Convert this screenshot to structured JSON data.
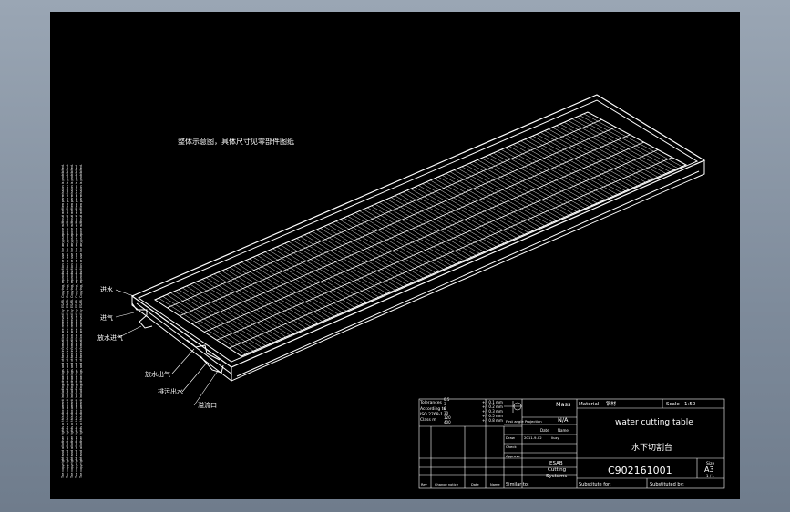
{
  "drawing": {
    "note": "整体示意图，具体尺寸见零部件图纸",
    "labels": {
      "inlet_water": "进水",
      "inlet_air": "进气",
      "drain_air": "放水进气",
      "drain_air2": "放水出气",
      "slag_port": "排污出水",
      "vent": "溢流口"
    },
    "side_text": "The copyright and all other rights to this document including drawings and other information are reserved by ESAB. Copying, reproduction or use for any purpose without written permission is prohibited."
  },
  "title_block": {
    "tolerances": {
      "heading": "Tolerances",
      "lines": [
        "According to",
        "ISO 2768-1",
        "Class m"
      ],
      "ranges": [
        "0.5",
        "3",
        "6",
        "30",
        "120",
        "400"
      ],
      "values": [
        "+/- 0.1 mm",
        "+/- 0.2 mm",
        "+/- 0.3 mm",
        "+/- 0.5 mm",
        "+/- 0.8 mm"
      ]
    },
    "first_angle": "First angle Projection",
    "mass_label": "Mass",
    "mass_value": "N/A",
    "material_label": "Material",
    "material_value": "钢材",
    "scale_label": "Scale",
    "scale_value": "1:50",
    "date_label": "Date",
    "name_label": "Name",
    "draw_label": "Draw",
    "draw_date": "2011-9-02",
    "draw_name": "liuzy",
    "check_label": "Check",
    "approve_label": "Approve",
    "title_en": "water cutting table",
    "title_cn": "水下切割台",
    "company": [
      "ESAB",
      "Cutting",
      "Systems"
    ],
    "drawing_no": "C902161001",
    "size_label": "Size",
    "size_value": "A3",
    "sheet_value": "1 / 1",
    "similar_label": "Similar to:",
    "substitute_for": "Substitute for:",
    "substituted_by": "Substituted by:",
    "rev_headers": [
      "Rev",
      "Change notice",
      "Date",
      "Name"
    ]
  }
}
